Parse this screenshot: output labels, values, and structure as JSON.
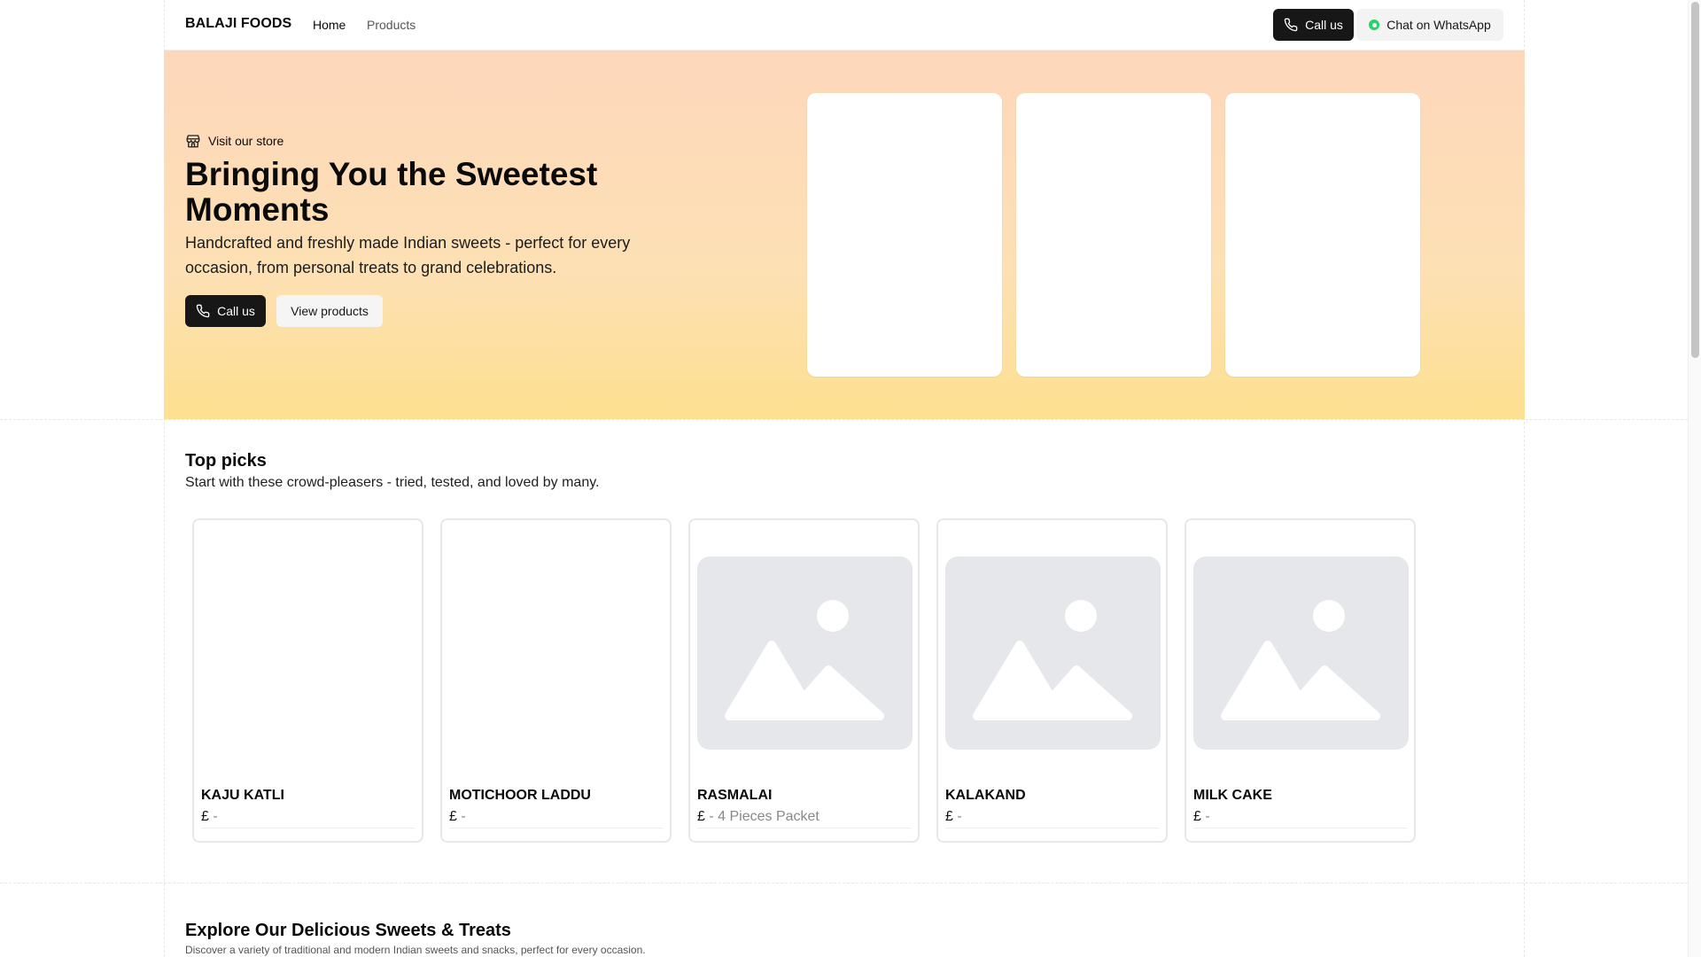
{
  "header": {
    "brand": "BALAJI FOODS",
    "nav": [
      {
        "label": "Home"
      },
      {
        "label": "Products"
      }
    ],
    "call_label": "Call us",
    "whatsapp_label": "Chat on WhatsApp"
  },
  "hero": {
    "eyebrow": "Visit our store",
    "title": "Bringing You the Sweetest Moments",
    "subtitle": "Handcrafted and freshly made Indian sweets - perfect for every occasion, from personal treats to grand celebrations.",
    "call_label": "Call us",
    "view_label": "View products"
  },
  "top_picks": {
    "title": "Top picks",
    "subtitle": "Start with these crowd-pleasers - tried, tested, and loved by many.",
    "products": [
      {
        "name": "KAJU KATLI",
        "currency": "£",
        "price_note": "-"
      },
      {
        "name": "MOTICHOOR LADDU",
        "currency": "£",
        "price_note": "-"
      },
      {
        "name": "RASMALAI",
        "currency": "£",
        "price_note": "- 4 Pieces Packet"
      },
      {
        "name": "KALAKAND",
        "currency": "£",
        "price_note": "-"
      },
      {
        "name": "MILK CAKE",
        "currency": "£",
        "price_note": "-"
      }
    ]
  },
  "explore": {
    "title": "Explore Our Delicious Sweets & Treats",
    "subtitle": "Discover a variety of traditional and modern Indian sweets and snacks, perfect for every occasion."
  },
  "icons": {
    "phone": "phone-icon",
    "whatsapp": "whatsapp-icon",
    "store": "store-icon",
    "image_placeholder": "image-placeholder-icon"
  },
  "colors": {
    "primary_button": "#171717",
    "whatsapp_green": "#25d366",
    "hero_gradient_top": "#fdd7bb",
    "hero_gradient_bottom": "#fde08f"
  }
}
